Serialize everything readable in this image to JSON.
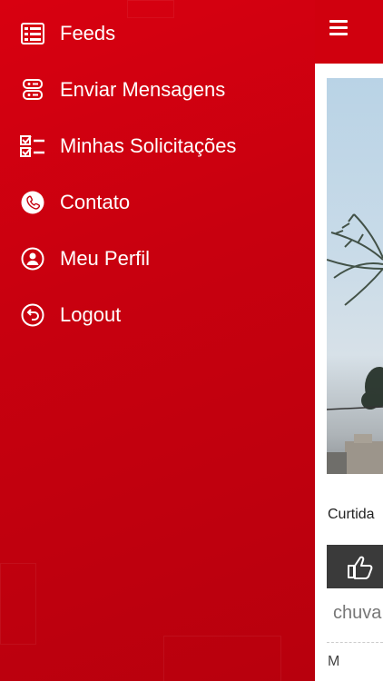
{
  "menu": {
    "items": [
      {
        "label": "Feeds",
        "icon": "feeds-icon"
      },
      {
        "label": "Enviar Mensagens",
        "icon": "messages-icon"
      },
      {
        "label": "Minhas Solicitações",
        "icon": "checklist-icon"
      },
      {
        "label": "Contato",
        "icon": "phone-icon"
      },
      {
        "label": "Meu Perfil",
        "icon": "user-icon"
      },
      {
        "label": "Logout",
        "icon": "logout-icon"
      }
    ]
  },
  "feed": {
    "likes_label": "Curtida",
    "comment_text": "chuva",
    "more_text": "M"
  },
  "colors": {
    "primary": "#c4000f",
    "header": "#d0000e"
  }
}
